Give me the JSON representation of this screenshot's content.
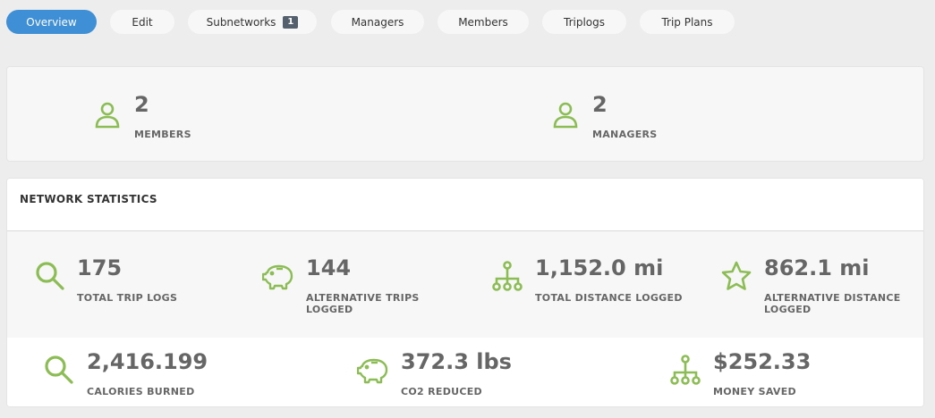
{
  "colors": {
    "accent": "#3f8fd6",
    "icon": "#8cbd55",
    "badge": "#55606e"
  },
  "tabs": [
    {
      "label": "Overview",
      "active": true
    },
    {
      "label": "Edit"
    },
    {
      "label": "Subnetworks",
      "badge": "1"
    },
    {
      "label": "Managers"
    },
    {
      "label": "Members"
    },
    {
      "label": "Triplogs"
    },
    {
      "label": "Trip Plans"
    }
  ],
  "summary": [
    {
      "icon": "user-icon",
      "value": "2",
      "label": "MEMBERS"
    },
    {
      "icon": "user-icon",
      "value": "2",
      "label": "MANAGERS"
    }
  ],
  "network_statistics": {
    "title": "NETWORK STATISTICS",
    "row1": [
      {
        "icon": "search-icon",
        "value": "175",
        "label": "TOTAL TRIP LOGS"
      },
      {
        "icon": "piggy-bank-icon",
        "value": "144",
        "label": "ALTERNATIVE TRIPS LOGGED"
      },
      {
        "icon": "hierarchy-icon",
        "value": "1,152.0 mi",
        "label": "TOTAL DISTANCE LOGGED"
      },
      {
        "icon": "star-icon",
        "value": "862.1 mi",
        "label": "ALTERNATIVE DISTANCE LOGGED"
      }
    ],
    "row2": [
      {
        "icon": "search-icon",
        "value": "2,416.199",
        "label": "CALORIES BURNED"
      },
      {
        "icon": "piggy-bank-icon",
        "value": "372.3 lbs",
        "label": "CO2 REDUCED"
      },
      {
        "icon": "hierarchy-icon",
        "value": "$252.33",
        "label": "MONEY SAVED"
      }
    ]
  }
}
